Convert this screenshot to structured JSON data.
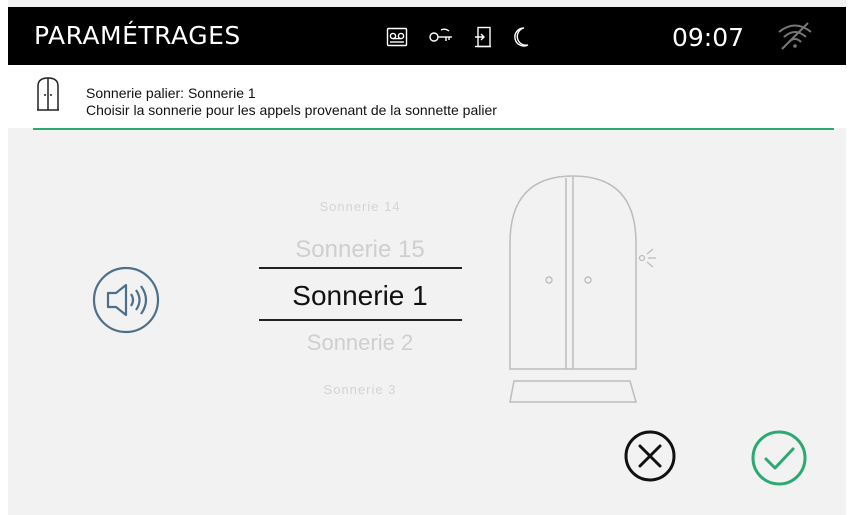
{
  "header": {
    "title": "PARAMÉTRAGES",
    "status_icons": [
      "voicemail-icon",
      "key-icon",
      "door-exit-icon",
      "moon-icon"
    ],
    "time": "09:07",
    "wifi_status": "wifi-off-icon"
  },
  "info": {
    "icon": "door-icon",
    "title": "Sonnerie palier: Sonnerie 1",
    "description": "Choisir la sonnerie pour les appels provenant de la sonnette palier"
  },
  "ringtone_picker": {
    "options": [
      "Sonnerie 14",
      "Sonnerie 15",
      "Sonnerie 1",
      "Sonnerie 2",
      "Sonnerie 3"
    ],
    "selected": "Sonnerie 1"
  },
  "actions": {
    "cancel_icon": "close-circle-icon",
    "confirm_icon": "check-circle-icon"
  },
  "colors": {
    "accent": "#2aa970",
    "topbar_bg": "#000000",
    "speaker_circle": "#4d6f8a"
  }
}
